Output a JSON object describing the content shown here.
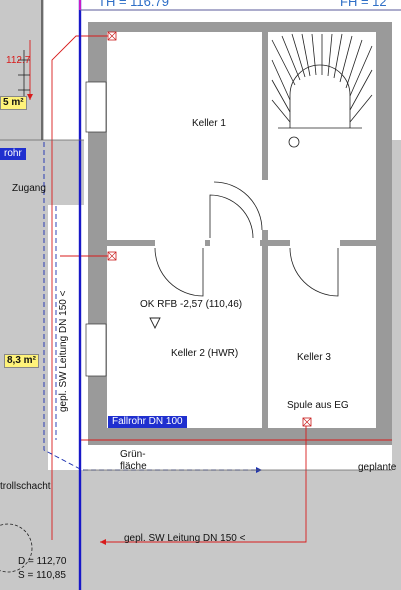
{
  "labels": {
    "header_left": "TH = 116.79",
    "header_right": "FH = 12",
    "left_red_value": "112.7",
    "area_top": "5 m²",
    "tag_left": "rohr",
    "zugang": "Zugang",
    "keller1": "Keller 1",
    "ok_rfb": "OK RFB -2,57 (110,46)",
    "keller2": "Keller 2 (HWR)",
    "keller3": "Keller 3",
    "area_mid": "8,3 m²",
    "sw_vertical": "gepl. SW Leitung DN 150 <",
    "spule": "Spule aus EG",
    "fallrohr": "Fallrohr DN 100",
    "gruen1": "Grün-",
    "gruen2": "fläche",
    "geplante": "geplante",
    "kontrollschacht": "trollschacht",
    "sw_bottom": "gepl. SW Leitung DN 150 <",
    "d_value": "D = 112,70",
    "s_value": "S = 110,85"
  },
  "colors": {
    "wall": "#9a9a9a",
    "surround": "#c8c8c8",
    "plan_line": "#d81b1b",
    "sewer_line": "#1a2fb0",
    "axis_line": "#1818c8",
    "label_box": "#1f2fcf",
    "area_tag": "#fff37a"
  }
}
